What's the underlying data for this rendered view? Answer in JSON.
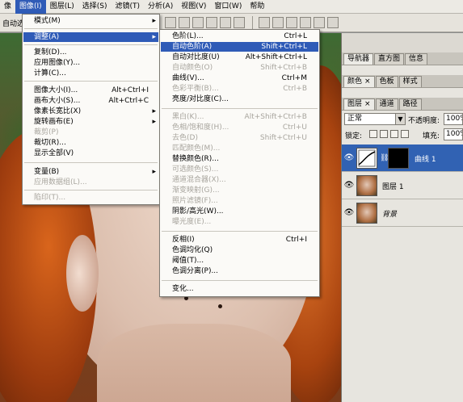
{
  "menubar": {
    "items": [
      {
        "label": "像"
      },
      {
        "label": "图像(I)",
        "active": true
      },
      {
        "label": "图层(L)"
      },
      {
        "label": "选择(S)"
      },
      {
        "label": "滤镜(T)"
      },
      {
        "label": "分析(A)"
      },
      {
        "label": "视图(V)"
      },
      {
        "label": "窗口(W)"
      },
      {
        "label": "帮助"
      }
    ]
  },
  "optbar": {
    "label": "自动选"
  },
  "image_menu": {
    "items": [
      {
        "label": "模式(M)",
        "submenu": true
      },
      {
        "label": "调整(A)",
        "submenu": true,
        "highlighted": true
      },
      {
        "label": "复制(D)..."
      },
      {
        "label": "应用图像(Y)..."
      },
      {
        "label": "计算(C)..."
      },
      {
        "label": "图像大小(I)...",
        "shortcut": "Alt+Ctrl+I"
      },
      {
        "label": "画布大小(S)...",
        "shortcut": "Alt+Ctrl+C"
      },
      {
        "label": "像素长宽比(X)",
        "submenu": true
      },
      {
        "label": "旋转画布(E)",
        "submenu": true
      },
      {
        "label": "裁剪(P)",
        "disabled": true
      },
      {
        "label": "裁切(R)..."
      },
      {
        "label": "显示全部(V)"
      },
      {
        "label": "变量(B)",
        "submenu": true
      },
      {
        "label": "应用数据组(L)...",
        "disabled": true
      },
      {
        "label": "陷印(T)...",
        "disabled": true
      }
    ]
  },
  "adjust_menu": {
    "items": [
      {
        "label": "色阶(L)...",
        "shortcut": "Ctrl+L"
      },
      {
        "label": "自动色阶(A)",
        "shortcut": "Shift+Ctrl+L",
        "highlighted": true
      },
      {
        "label": "自动对比度(U)",
        "shortcut": "Alt+Shift+Ctrl+L"
      },
      {
        "label": "自动颜色(O)",
        "shortcut": "Shift+Ctrl+B",
        "disabled": true
      },
      {
        "label": "曲线(V)...",
        "shortcut": "Ctrl+M"
      },
      {
        "label": "色彩平衡(B)...",
        "shortcut": "Ctrl+B",
        "disabled": true
      },
      {
        "label": "亮度/对比度(C)..."
      },
      {
        "label": "黑白(K)...",
        "shortcut": "Alt+Shift+Ctrl+B",
        "disabled": true
      },
      {
        "label": "色相/饱和度(H)...",
        "shortcut": "Ctrl+U",
        "disabled": true
      },
      {
        "label": "去色(D)",
        "shortcut": "Shift+Ctrl+U",
        "disabled": true
      },
      {
        "label": "匹配颜色(M)...",
        "disabled": true
      },
      {
        "label": "替换颜色(R)..."
      },
      {
        "label": "可选颜色(S)...",
        "disabled": true
      },
      {
        "label": "通道混合器(X)...",
        "disabled": true
      },
      {
        "label": "渐变映射(G)...",
        "disabled": true
      },
      {
        "label": "照片滤镜(F)...",
        "disabled": true
      },
      {
        "label": "阴影/高光(W)..."
      },
      {
        "label": "曝光度(E)...",
        "disabled": true
      },
      {
        "label": "反相(I)",
        "shortcut": "Ctrl+I"
      },
      {
        "label": "色调均化(Q)"
      },
      {
        "label": "阈值(T)..."
      },
      {
        "label": "色调分离(P)..."
      },
      {
        "label": "变化..."
      }
    ]
  },
  "panels": {
    "group1_tabs": [
      {
        "label": "导航器"
      },
      {
        "label": "直方图"
      },
      {
        "label": "信息"
      }
    ],
    "group2_tabs": [
      {
        "label": "颜色"
      },
      {
        "label": "色板"
      },
      {
        "label": "样式"
      }
    ],
    "group3_tabs": [
      {
        "label": "图层"
      },
      {
        "label": "通道"
      },
      {
        "label": "路径"
      }
    ],
    "close_glyph": "×",
    "blend_mode": "正常",
    "opacity_label": "不透明度:",
    "opacity_value": "100%",
    "lock_label": "锁定:",
    "fill_label": "填充:",
    "fill_value": "100%",
    "layers": [
      {
        "name": "曲线 1",
        "selected": true
      },
      {
        "name": "图层 1"
      },
      {
        "name": "背景"
      }
    ]
  }
}
